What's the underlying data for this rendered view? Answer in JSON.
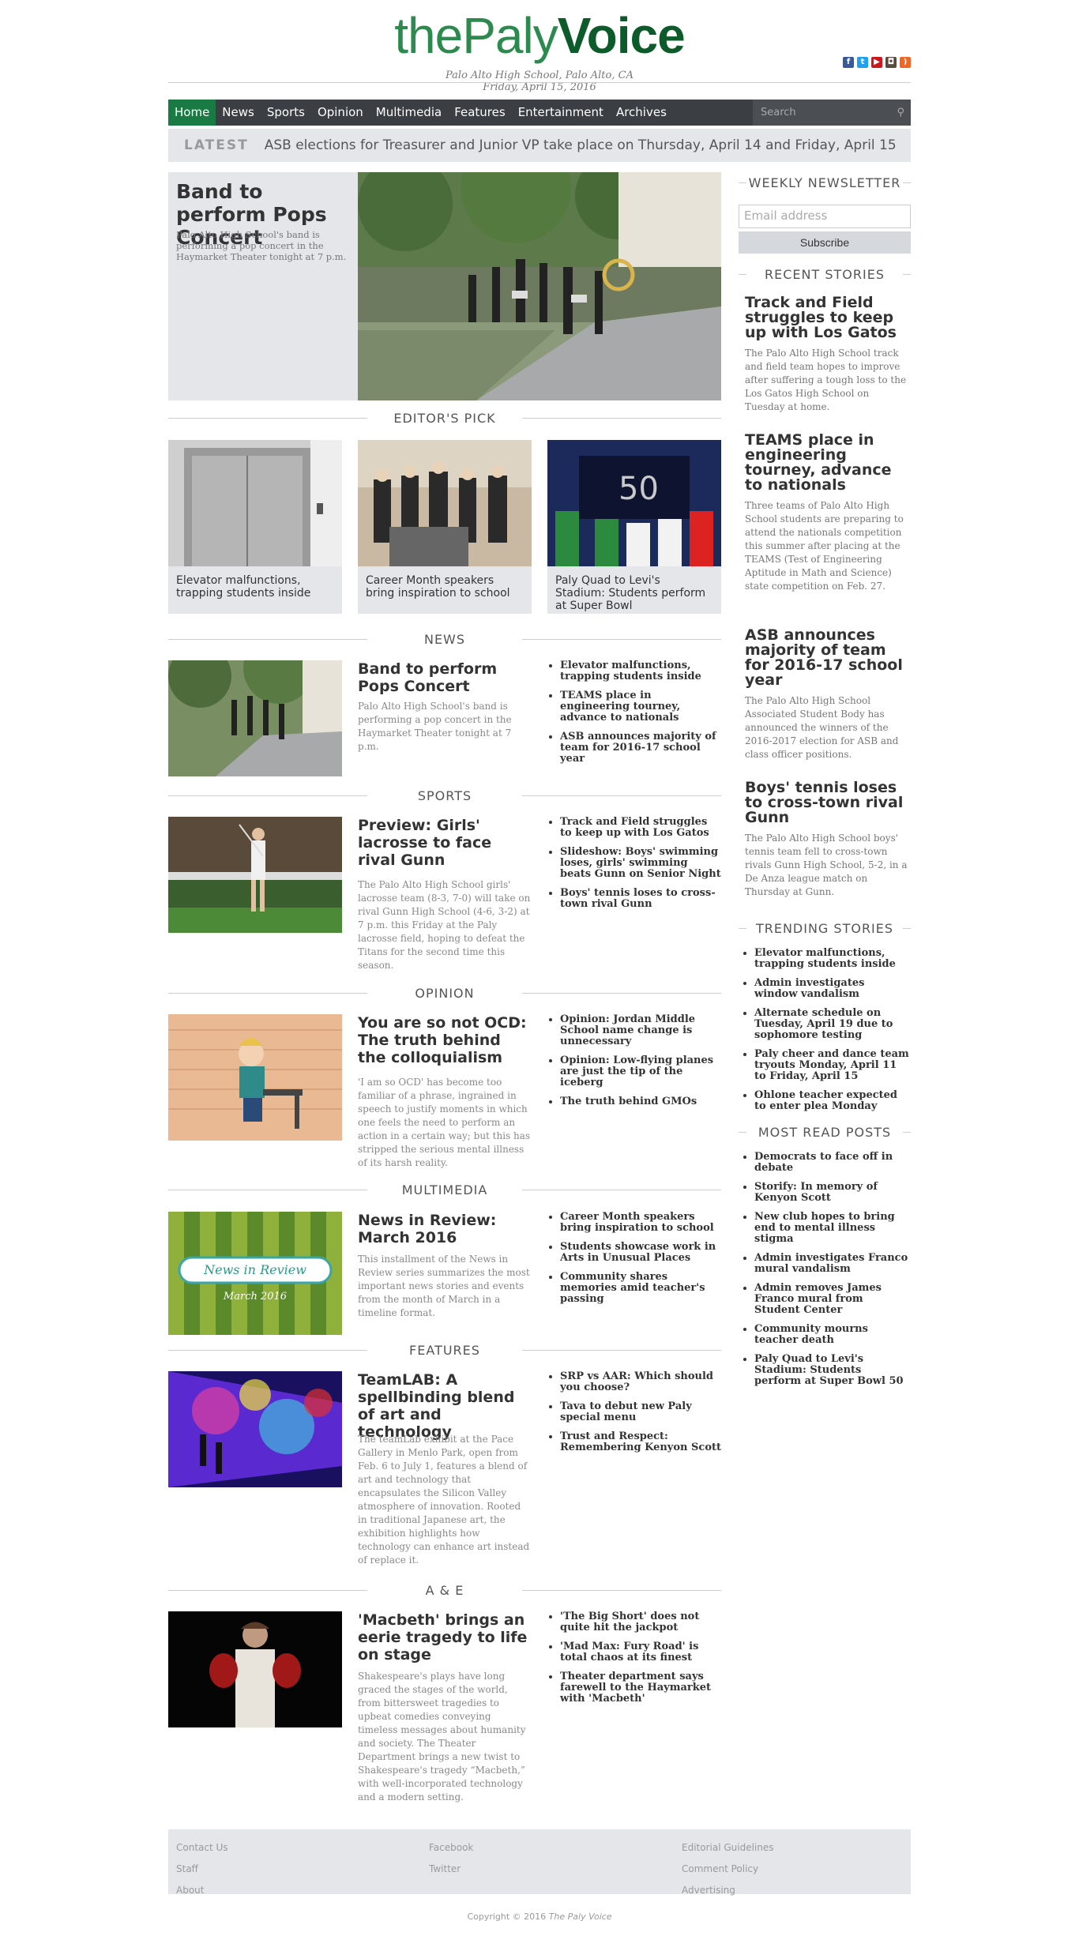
{
  "header": {
    "logo_the": "the",
    "logo_paly": "Paly",
    "logo_voice": "Voice",
    "location": "Palo Alto High School, Palo Alto, CA",
    "date": "Friday, April 15, 2016"
  },
  "nav": {
    "items": [
      "Home",
      "News",
      "Sports",
      "Opinion",
      "Multimedia",
      "Features",
      "Entertainment",
      "Archives"
    ],
    "search_placeholder": "Search"
  },
  "latest": {
    "label": "LATEST",
    "text": "ASB elections for Treasurer and Junior VP take place on Thursday, April 14 and Friday, April 15"
  },
  "hero": {
    "title": "Band to perform Pops Concert",
    "summary": "Palo Alto High School's band is performing a pop concert in the Haymarket Theater tonight at 7 p.m."
  },
  "editors_pick": {
    "title": "EDITOR'S PICK",
    "items": [
      "Elevator malfunctions, trapping students inside",
      "Career Month speakers bring inspiration to school",
      "Paly Quad to Levi's Stadium: Students perform at Super Bowl"
    ]
  },
  "sections": [
    {
      "title": "NEWS",
      "headline": "Band to perform Pops Concert",
      "summary": "Palo Alto High School's band is performing a pop concert in the Haymarket Theater tonight at 7 p.m.",
      "links": [
        "Elevator malfunctions, trapping students inside",
        "TEAMS place in engineering tourney, advance to nationals",
        "ASB announces majority of team for 2016-17 school year"
      ]
    },
    {
      "title": "SPORTS",
      "headline": "Preview: Girls' lacrosse to face rival Gunn",
      "summary": "The Palo Alto High School girls' lacrosse team (8-3, 7-0) will take on rival Gunn High School (4-6, 3-2) at 7 p.m. this Friday at the Paly lacrosse field, hoping to defeat the Titans for the second time this season.",
      "links": [
        "Track and Field struggles to keep up with Los Gatos",
        "Slideshow: Boys' swimming loses, girls' swimming beats Gunn on Senior Night",
        "Boys' tennis loses to cross-town rival Gunn"
      ]
    },
    {
      "title": "OPINION",
      "headline": "You are so not OCD: The truth behind the colloquialism",
      "summary": "'I am so OCD' has become too familiar of a phrase, ingrained in speech to justify moments in which one feels the need to perform an action in a certain way; but this has stripped the serious mental illness of its harsh reality.",
      "links": [
        "Opinion: Jordan Middle School name change is unnecessary",
        "Opinion: Low-flying planes are just the tip of the iceberg",
        "The truth behind GMOs"
      ]
    },
    {
      "title": "MULTIMEDIA",
      "headline": "News in Review: March 2016",
      "summary": "This installment of the News in Review series summarizes the most important news stories and events from the month of March in a timeline format.",
      "links": [
        "Career Month speakers bring inspiration to school",
        "Students showcase work in Arts in Unusual Places",
        "Community shares memories amid teacher's passing"
      ],
      "banner_title": "News in Review",
      "banner_sub": "March 2016"
    },
    {
      "title": "FEATURES",
      "headline": "TeamLAB: A spellbinding blend of art and technology",
      "summary": "The teamLab exhibit at the Pace Gallery in Menlo Park, open from Feb. 6 to July 1, features a blend of art and technology that encapsulates the Silicon Valley atmosphere of innovation. Rooted in traditional Japanese art, the exhibition highlights how technology can enhance art instead of replace it.",
      "links": [
        "SRP vs AAR: Which should you choose?",
        "Tava to debut new Paly special menu",
        "Trust and Respect: Remembering Kenyon Scott"
      ]
    },
    {
      "title": "A & E",
      "headline": "'Macbeth' brings an eerie tragedy to life on stage",
      "summary": "Shakespeare's plays have long graced the stages of the world, from bittersweet tragedies to upbeat comedies conveying timeless messages about humanity and society. The Theater Department brings a new twist to Shakespeare's tragedy “Macbeth,” with well-incorporated technology and a modern setting.",
      "links": [
        "'The Big Short' does not quite hit the jackpot",
        "'Mad Max: Fury Road' is total chaos at its finest",
        "Theater department says farewell to the Haymarket with 'Macbeth'"
      ]
    }
  ],
  "sidebar": {
    "newsletter": {
      "title": "WEEKLY NEWSLETTER",
      "placeholder": "Email address",
      "button": "Subscribe"
    },
    "recent": {
      "title": "RECENT STORIES",
      "items": [
        {
          "title": "Track and Field struggles to keep up with Los Gatos",
          "summary": "The Palo Alto High School track and field team hopes to improve after suffering a tough loss to the Los Gatos High School on Tuesday at home."
        },
        {
          "title": "TEAMS place in engineering tourney, advance to nationals",
          "summary": "Three teams of Palo Alto High School students are preparing to attend the nationals competition this summer after placing at the TEAMS (Test of Engineering Aptitude in Math and Science) state competition on Feb. 27."
        },
        {
          "title": "ASB announces majority of team for 2016-17 school year",
          "summary": "The Palo Alto High School Associated Student Body has announced the winners of the 2016-2017 election for ASB and class officer positions."
        },
        {
          "title": "Boys' tennis loses to cross-town rival Gunn",
          "summary": "The Palo Alto High School boys' tennis team fell to cross-town rivals Gunn High School, 5-2, in a De Anza league match on Thursday at Gunn."
        }
      ]
    },
    "trending": {
      "title": "TRENDING STORIES",
      "items": [
        "Elevator malfunctions, trapping students inside",
        "Admin investigates window vandalism",
        "Alternate schedule on Tuesday, April 19 due to sophomore testing",
        "Paly cheer and dance team tryouts Monday, April 11 to Friday, April 15",
        "Ohlone teacher expected to enter plea Monday"
      ]
    },
    "mostread": {
      "title": "MOST READ POSTS",
      "items": [
        "Democrats to face off in debate",
        "Storify: In memory of Kenyon Scott",
        "New club hopes to bring end to mental illness stigma",
        "Admin investigates Franco mural vandalism",
        "Admin removes James Franco mural from Student Center",
        "Community mourns teacher death",
        "Paly Quad to Levi's Stadium: Students perform at Super Bowl 50"
      ]
    }
  },
  "footer": {
    "col1": [
      "Contact Us",
      "Staff",
      "About"
    ],
    "col2": [
      "Facebook",
      "Twitter"
    ],
    "col3": [
      "Editorial Guidelines",
      "Comment Policy",
      "Advertising"
    ],
    "copyright": "Copyright © 2016",
    "copyright_name": "The Paly Voice"
  },
  "colors": {
    "brand_green": "#1a7a44",
    "nav_bg": "#3b3e42",
    "panel_gray": "#e4e6e9"
  }
}
